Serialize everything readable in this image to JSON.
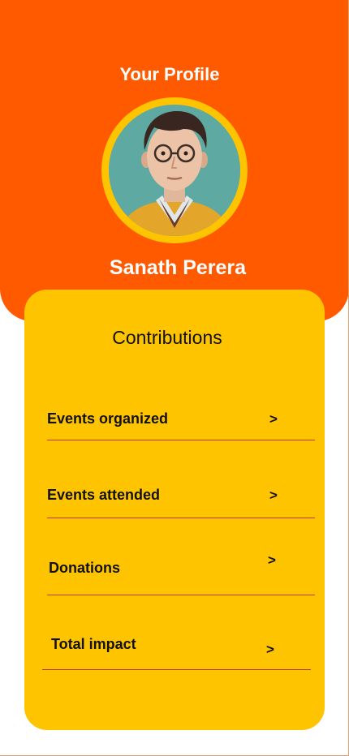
{
  "header": {
    "title": "Your Profile",
    "user_name": "Sanath Perera"
  },
  "contributions": {
    "title": "Contributions",
    "items": [
      {
        "label": "Events organized",
        "chevron": ">"
      },
      {
        "label": "Events attended",
        "chevron": ">"
      },
      {
        "label": "Donations",
        "chevron": ">"
      },
      {
        "label": "Total impact",
        "chevron": ">"
      }
    ]
  },
  "colors": {
    "header_bg": "#ff5a00",
    "card_bg": "#ffc400",
    "avatar_ring": "#ffc400",
    "divider": "#c0392b",
    "text_light": "#ffffff",
    "text_dark": "#111111"
  },
  "icons": {
    "avatar": "user-avatar-portrait",
    "row_chevron": "chevron-right-icon"
  }
}
